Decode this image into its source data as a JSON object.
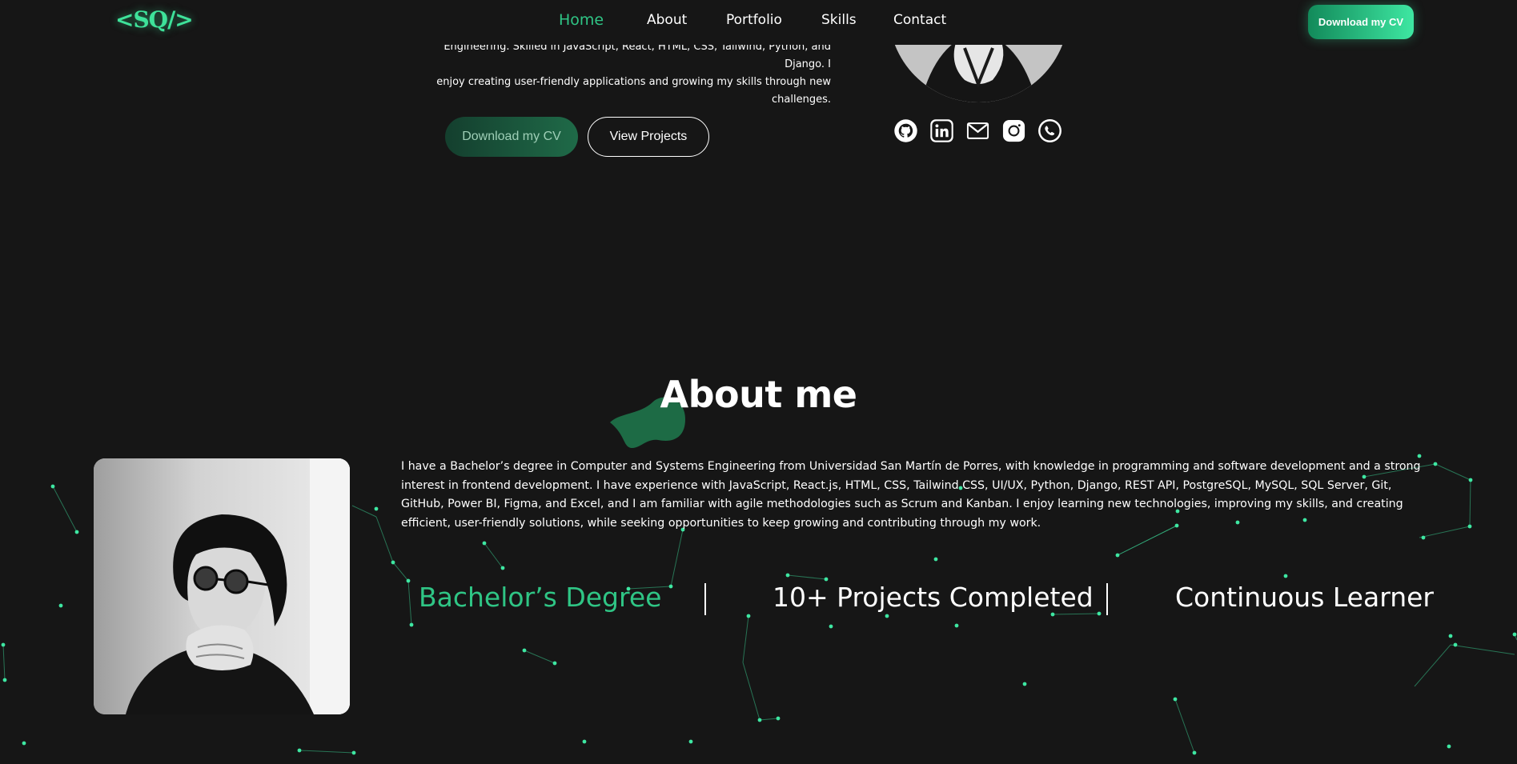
{
  "navbar": {
    "logo": "<SQ/>",
    "links": [
      "Home",
      "About",
      "Portfolio",
      "Skills",
      "Contact"
    ],
    "active_link": "Home",
    "cv_button": "Download my CV"
  },
  "hero": {
    "intro_lines": [
      "Engineering. Skilled in JavaScript, React, HTML, CSS, Tailwind, Python, and Django. I",
      "enjoy creating user-friendly applications and growing my skills through new",
      "challenges."
    ],
    "cv_button": "Download my CV",
    "projects_button": "View Projects",
    "socials": [
      "github-icon",
      "linkedin-icon",
      "mail-icon",
      "instagram-icon",
      "whatsapp-icon"
    ]
  },
  "about": {
    "title": "About me",
    "paragraph": "I have a Bachelor’s degree in Computer and Systems Engineering from Universidad San Martín de Porres, with knowledge in programming and software development and a strong interest in frontend development. I have experience with JavaScript, React.js, HTML, CSS, Tailwind CSS, UI/UX, Python, Django, REST API, PostgreSQL, MySQL, SQL Server, Git, GitHub, Power BI, Figma, and Excel, and I am familiar with agile methodologies such as Scrum and Kanban. I enjoy learning new technologies, improving my skills, and creating efficient, user-friendly solutions, while seeking opportunities to keep growing and contributing through my work.",
    "stats": [
      "Bachelor’s Degree",
      "10+ Projects Completed",
      "Continuous Learner"
    ]
  },
  "colors": {
    "background": "#161616",
    "accent": "#2fc585",
    "accent_bright": "#3ee29a",
    "particle": "#3ee7a2"
  }
}
